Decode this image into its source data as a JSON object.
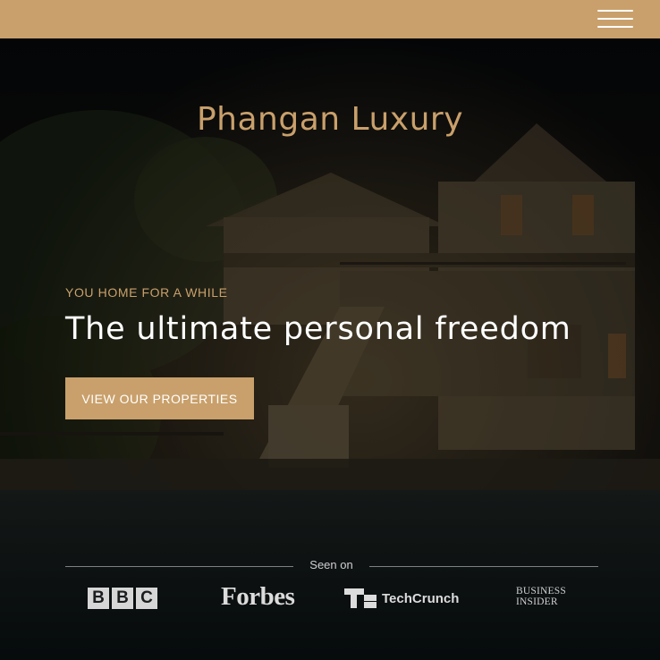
{
  "header": {
    "menu_icon": "hamburger-menu-icon",
    "bar_color": "#c9a06b"
  },
  "hero": {
    "brand": "Phangan Luxury",
    "tagline": "YOU HOME FOR A WHILE",
    "headline": "The ultimate personal freedom",
    "cta_label": "VIEW OUR PROPERTIES",
    "background_image": "night-villa-photo"
  },
  "seen_on": {
    "label": "Seen on",
    "logos": {
      "bbc": [
        "B",
        "B",
        "C"
      ],
      "forbes": "Forbes",
      "techcrunch": "TechCrunch",
      "business_insider_line1": "BUSINESS",
      "business_insider_line2": "INSIDER"
    }
  },
  "colors": {
    "accent": "#c9a06b",
    "headline": "#ffffff",
    "background": "#0b0d0f"
  }
}
